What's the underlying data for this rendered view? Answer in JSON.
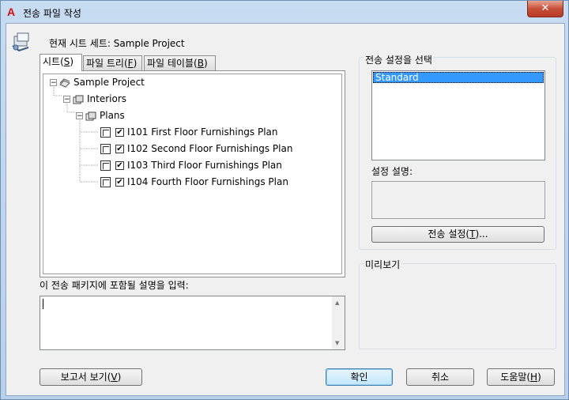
{
  "window": {
    "title": "전송 파일 작성",
    "close_label": "✕"
  },
  "header": {
    "current_sheet_set": "현재 시트 세트: Sample Project"
  },
  "tabs": [
    {
      "label": "시트(",
      "key": "S",
      "suffix": ")"
    },
    {
      "label": "파일 트리(",
      "key": "F",
      "suffix": ")"
    },
    {
      "label": "파일 테이블(",
      "key": "B",
      "suffix": ")"
    }
  ],
  "tree": {
    "root": "Sample Project",
    "folder1": "Interiors",
    "folder2": "Plans",
    "sheets": [
      "I101 First Floor Furnishings Plan",
      "I102 Second Floor Furnishings Plan",
      "I103 Third Floor Furnishings Plan",
      "I104 Fourth Floor Furnishings Plan"
    ]
  },
  "notes": {
    "label": "이 전송 패키지에 포함될 설명을 입력:",
    "value": ""
  },
  "transmittal": {
    "setup_label": "전송 설정을 선택",
    "setups": [
      "Standard"
    ],
    "desc_label": "설정 설명:",
    "desc_value": "",
    "setups_button": "전송 설정(",
    "setups_key": "T",
    "setups_suffix": ")..."
  },
  "preview": {
    "label": "미리보기"
  },
  "buttons": {
    "report": "보고서 보기(",
    "report_key": "V",
    "report_suffix": ")",
    "ok": "확인",
    "cancel": "취소",
    "help": "도움말(",
    "help_key": "H",
    "help_suffix": ")"
  }
}
